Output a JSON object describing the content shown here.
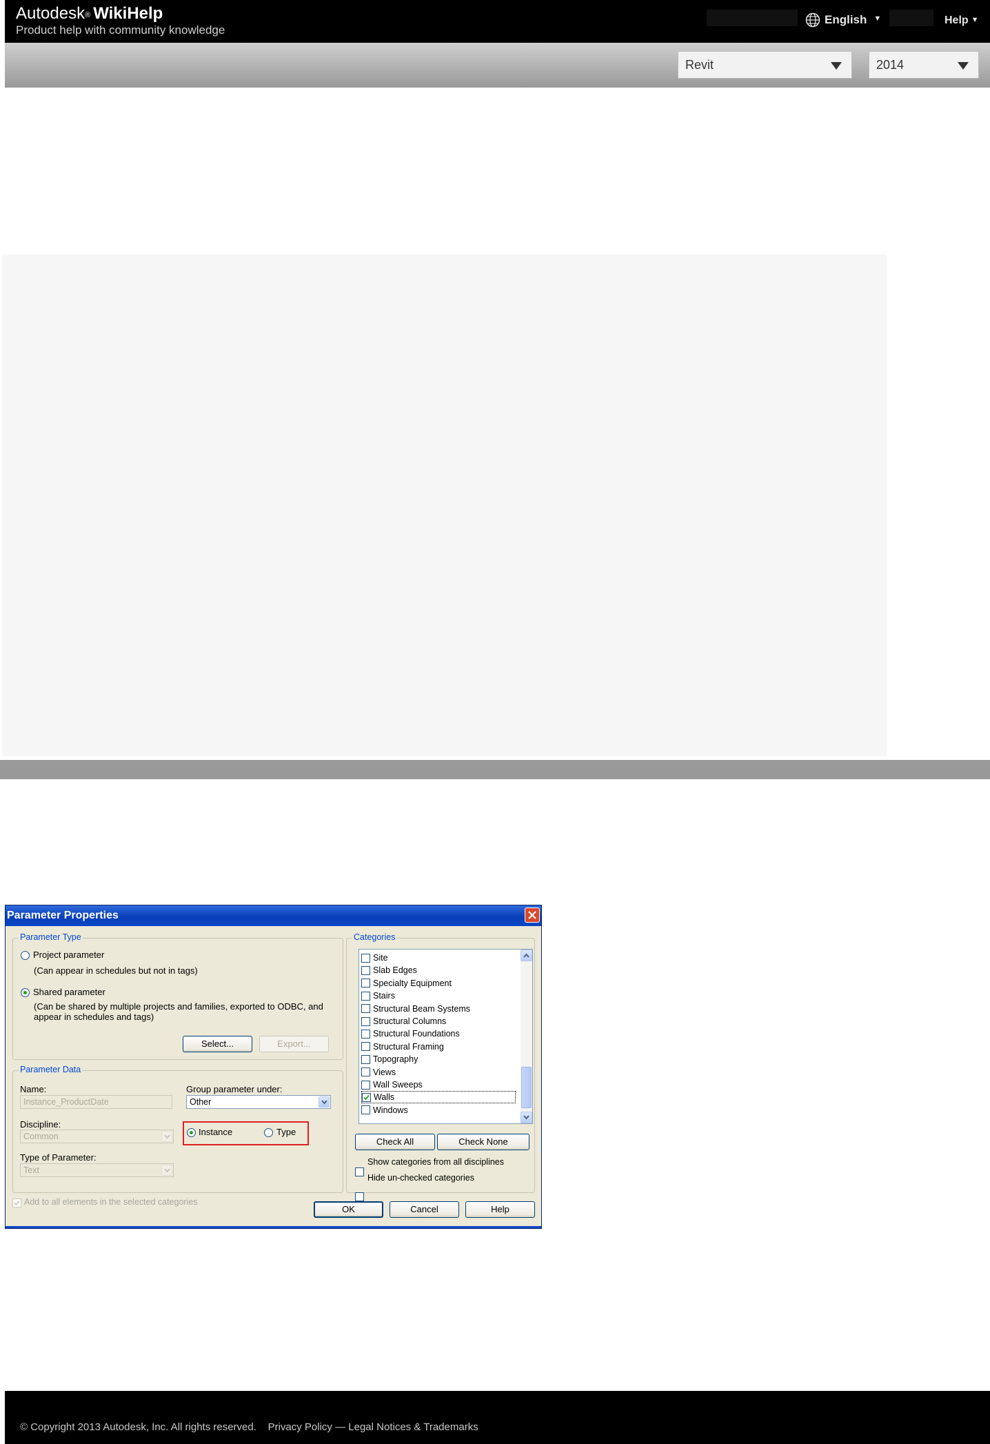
{
  "header": {
    "brand_name": "Autodesk",
    "brand_reg": "®",
    "brand_product": "WikiHelp",
    "tagline": "Product help with community knowledge",
    "language_label": "English",
    "help_label": "Help",
    "caret": "▼"
  },
  "product_bar": {
    "product_value": "Revit",
    "version_value": "2014"
  },
  "dialog": {
    "title": "Parameter Properties",
    "parameter_type": {
      "title": "Parameter Type",
      "project_label": "Project parameter",
      "project_desc": "(Can appear in schedules but not in tags)",
      "shared_label": "Shared parameter",
      "shared_desc_line1": "(Can be shared by multiple projects and families, exported to ODBC, and",
      "shared_desc_line2": "appear in schedules and tags)",
      "select_button": "Select...",
      "export_button": "Export...",
      "selected": "shared"
    },
    "parameter_data": {
      "title": "Parameter Data",
      "name_label": "Name:",
      "name_value": "Instance_ProductDate",
      "group_label": "Group parameter under:",
      "group_value": "Other",
      "discipline_label": "Discipline:",
      "discipline_value": "Common",
      "type_param_label": "Type of Parameter:",
      "type_param_value": "Text",
      "instance_label": "Instance",
      "type_label": "Type",
      "selected": "instance"
    },
    "add_to_all_label": "Add to all elements in the selected categories",
    "categories": {
      "title": "Categories",
      "items": [
        {
          "label": "Site",
          "checked": false
        },
        {
          "label": "Slab Edges",
          "checked": false
        },
        {
          "label": "Specialty Equipment",
          "checked": false
        },
        {
          "label": "Stairs",
          "checked": false
        },
        {
          "label": "Structural Beam Systems",
          "checked": false
        },
        {
          "label": "Structural Columns",
          "checked": false
        },
        {
          "label": "Structural Foundations",
          "checked": false
        },
        {
          "label": "Structural Framing",
          "checked": false
        },
        {
          "label": "Topography",
          "checked": false
        },
        {
          "label": "Views",
          "checked": false
        },
        {
          "label": "Wall Sweeps",
          "checked": false
        },
        {
          "label": "Walls",
          "checked": true
        },
        {
          "label": "Windows",
          "checked": false
        }
      ],
      "check_all_button": "Check All",
      "check_none_button": "Check None",
      "show_all_disciplines_label": "Show categories from all disciplines",
      "hide_unchecked_label": "Hide un-checked categories"
    },
    "ok_button": "OK",
    "cancel_button": "Cancel",
    "help_button": "Help"
  },
  "footer": {
    "copyright": "© Copyright 2013 Autodesk, Inc. All rights reserved.",
    "privacy_link": "Privacy Policy",
    "separator": "—",
    "legal_link": "Legal Notices & Trademarks"
  },
  "colors": {
    "header_bg": "#000000",
    "dialog_face": "#ece9d8",
    "titlebar_blue": "#0a3fb8",
    "group_title_blue": "#0046d5",
    "highlight_red": "#e02020"
  }
}
